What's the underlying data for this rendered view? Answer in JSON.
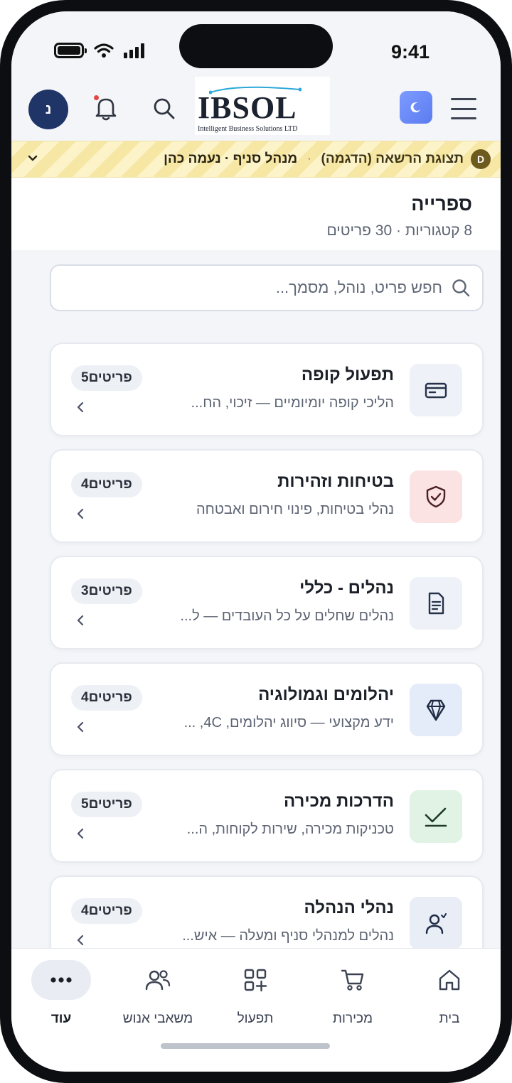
{
  "status_bar": {
    "time": "9:41"
  },
  "header": {
    "logo_text": "IBSOL",
    "logo_tagline": "Intelligent Business Solutions LTD",
    "avatar_initial": "נ"
  },
  "demo_banner": {
    "badge": "D",
    "label": "תצוגת הרשאה (הדגמה)",
    "separator": "·",
    "user": "מנהל סניף · נעמה כהן"
  },
  "page": {
    "title": "ספרייה",
    "subtitle": "8 קטגוריות · 30 פריטים"
  },
  "search": {
    "placeholder": "חפש פריט, נוהל, מסמך..."
  },
  "categories": [
    {
      "title": "תפעול קופה",
      "description": "הליכי קופה יומיומיים — זיכוי, הח...",
      "count": "5פריטים",
      "icon": "credit-card-icon",
      "color": "#eef2f8"
    },
    {
      "title": "בטיחות וזהירות",
      "description": "נהלי בטיחות, פינוי חירום ואבטחה",
      "count": "4פריטים",
      "icon": "shield-check-icon",
      "color": "#fbe3e3"
    },
    {
      "title": "נהלים - כללי",
      "description": "נהלים שחלים על כל העובדים — ל...",
      "count": "3פריטים",
      "icon": "document-icon",
      "color": "#eef2f8"
    },
    {
      "title": "יהלומים וגמולוגיה",
      "description": "ידע מקצועי — סיווג יהלומים, 4C, ...",
      "count": "4פריטים",
      "icon": "diamond-icon",
      "color": "#e3ecf8"
    },
    {
      "title": "הדרכות מכירה",
      "description": "טכניקות מכירה, שירות לקוחות, ה...",
      "count": "5פריטים",
      "icon": "chart-check-icon",
      "color": "#e1f3e5"
    },
    {
      "title": "נהלי הנהלה",
      "description": "נהלים למנהלי סניף ומעלה — איש...",
      "count": "4פריטים",
      "icon": "user-manager-icon",
      "color": "#e8edf6"
    }
  ],
  "bottom_nav": [
    {
      "label": "בית",
      "icon": "home-icon"
    },
    {
      "label": "מכירות",
      "icon": "cart-icon"
    },
    {
      "label": "תפעול",
      "icon": "grid-plus-icon"
    },
    {
      "label": "משאבי אנוש",
      "icon": "people-icon"
    },
    {
      "label": "עוד",
      "icon": "more-icon",
      "active": true
    }
  ]
}
